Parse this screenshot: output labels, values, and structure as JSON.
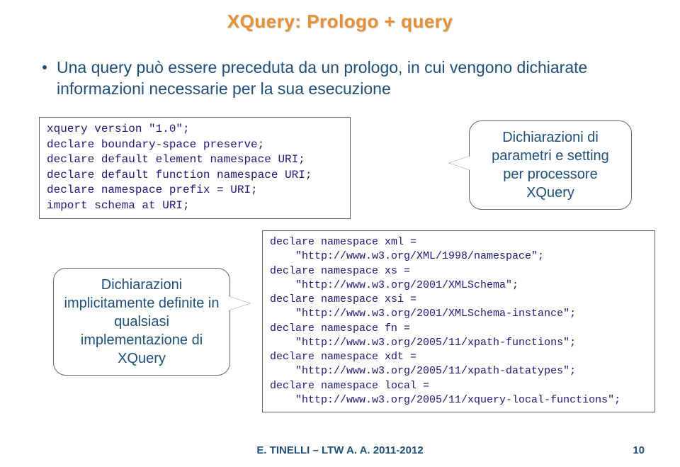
{
  "title": "XQuery: Prologo + query",
  "bullet": "Una query può essere preceduta da un prologo, in cui vengono dichiarate informazioni necessarie per la sua esecuzione",
  "codeBox1": {
    "l0": "xquery version \"1.0\";",
    "l1": "declare boundary-space preserve;",
    "l2": "declare default element namespace URI;",
    "l3": "declare default function namespace URI;",
    "l4": "declare namespace prefix = URI;",
    "l5": "import schema at URI;"
  },
  "callout1": "Dichiarazioni di parametri e setting per processore XQuery",
  "callout2": "Dichiarazioni implicitamente definite in qualsiasi implementazione di XQuery",
  "codeBox2": {
    "l0": "declare namespace xml =",
    "l1": "    \"http://www.w3.org/XML/1998/namespace\";",
    "l2": "declare namespace xs =",
    "l3": "    \"http://www.w3.org/2001/XMLSchema\";",
    "l4": "declare namespace xsi =",
    "l5": "    \"http://www.w3.org/2001/XMLSchema-instance\";",
    "l6": "declare namespace fn =",
    "l7": "    \"http://www.w3.org/2005/11/xpath-functions\";",
    "l8": "declare namespace xdt =",
    "l9": "    \"http://www.w3.org/2005/11/xpath-datatypes\";",
    "l10": "declare namespace local =",
    "l11": "    \"http://www.w3.org/2005/11/xquery-local-functions\";"
  },
  "footer": "E. TINELLI – LTW  A. A.  2011-2012",
  "pageNumber": "10"
}
